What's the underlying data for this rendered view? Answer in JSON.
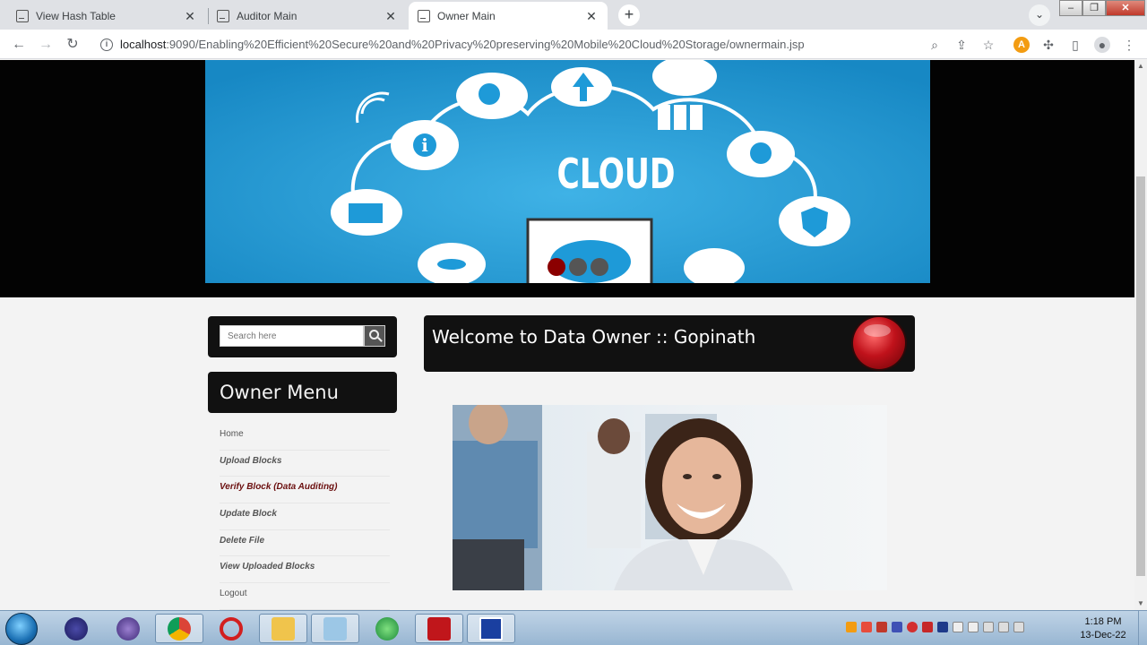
{
  "browser": {
    "tabs": [
      {
        "title": "View Hash Table",
        "active": false
      },
      {
        "title": "Auditor Main",
        "active": false
      },
      {
        "title": "Owner Main",
        "active": true
      }
    ],
    "url_host": "localhost",
    "url_path": ":9090/Enabling%20Efficient%20Secure%20and%20Privacy%20preserving%20Mobile%20Cloud%20Storage/ownermain.jsp"
  },
  "banner": {
    "title": "CLOUD"
  },
  "sidebar": {
    "search_placeholder": "Search here",
    "menu_title": "Owner Menu",
    "items": [
      {
        "label": "Home"
      },
      {
        "label": "Upload Blocks"
      },
      {
        "label": "Verify Block (Data Auditing)"
      },
      {
        "label": "Update Block"
      },
      {
        "label": "Delete File"
      },
      {
        "label": "View Uploaded Blocks"
      },
      {
        "label": "Logout"
      }
    ]
  },
  "main": {
    "welcome_text": "Welcome to Data Owner :: Gopinath"
  },
  "taskbar": {
    "time": "1:18 PM",
    "date": "13-Dec-22"
  },
  "colors": {
    "banner_blue": "#1e9ad8",
    "panel_black": "#111111",
    "accent_red": "#c0121b"
  }
}
